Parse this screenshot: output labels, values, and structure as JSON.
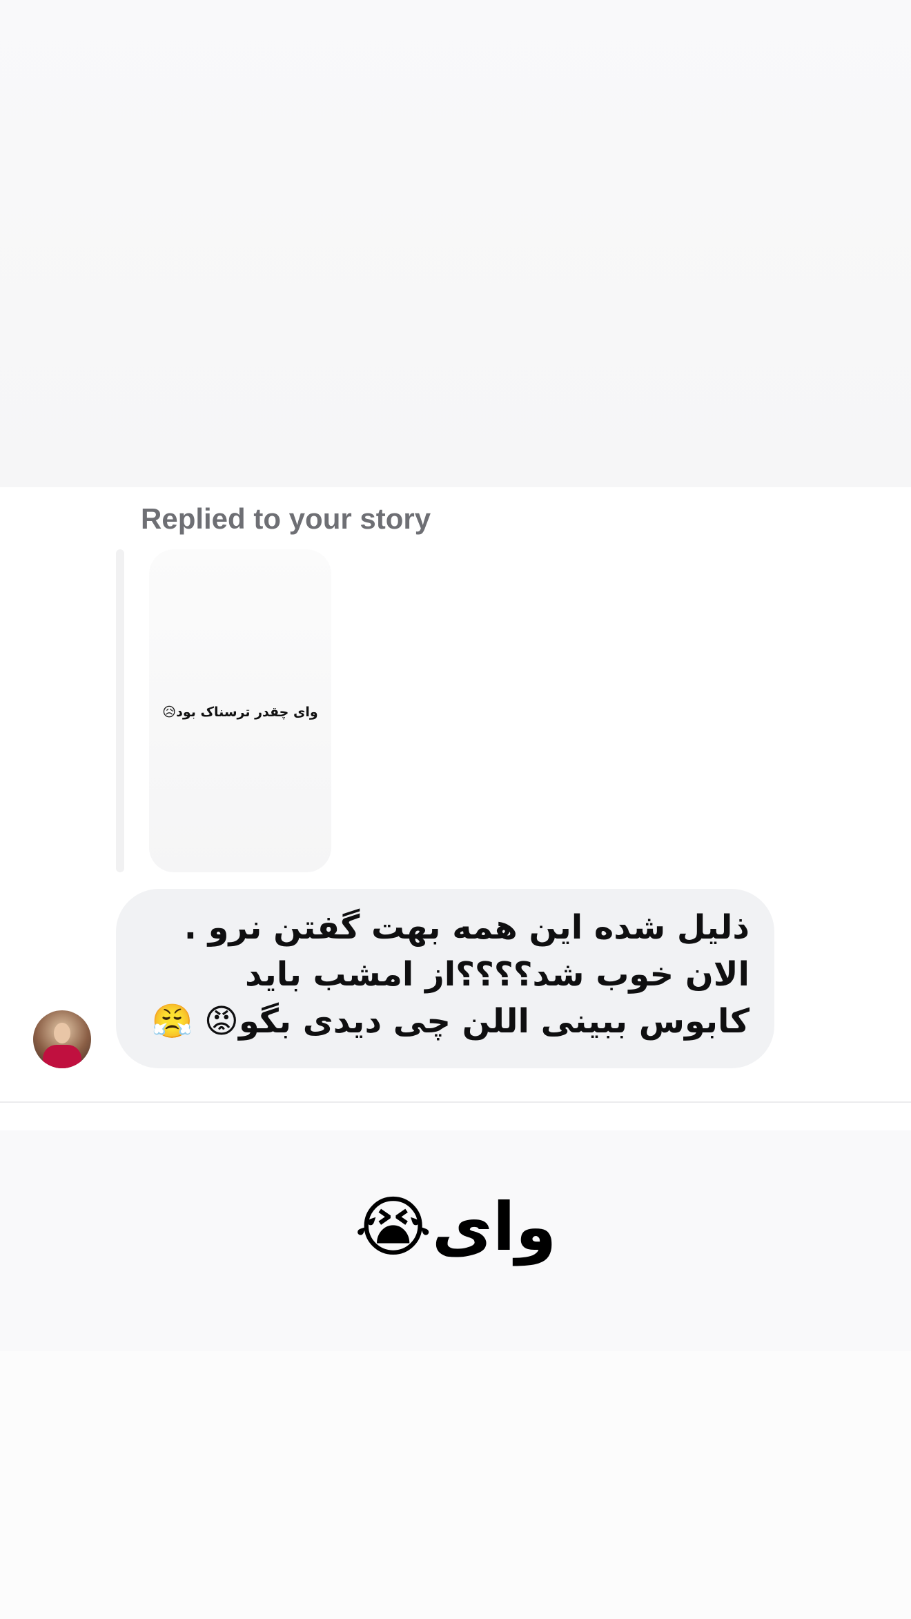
{
  "reply": {
    "label": "Replied to your story"
  },
  "story": {
    "text": "وای چقدر ترسناک بود😥"
  },
  "message": {
    "text": "ذلیل شده این همه بهت گفتن نرو . الان خوب شد؟؟؟؟از امشب باید کابوس ببینی اللن چی دیدی بگو😡 😤"
  },
  "bottom_story": {
    "text": "وای😭"
  },
  "colors": {
    "bubble": "#f1f2f4",
    "label": "#6e6f74",
    "reply_bar": "#f1f1f2"
  }
}
